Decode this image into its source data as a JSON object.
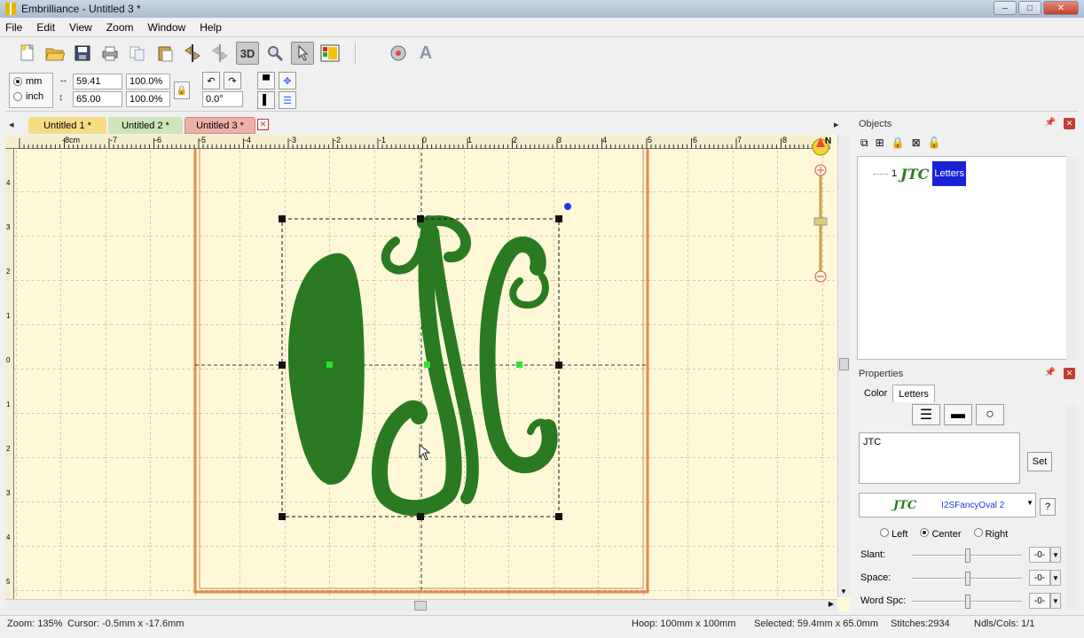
{
  "window": {
    "title": "Embrilliance -  Untitled 3 *",
    "minimize": "–",
    "maximize": "□",
    "close": "✕"
  },
  "menu": [
    "File",
    "Edit",
    "View",
    "Zoom",
    "Window",
    "Help"
  ],
  "toolbar": {
    "three_d": "3D"
  },
  "toolbar2": {
    "unit_mm": "mm",
    "unit_inch": "inch",
    "width_value": "59.41",
    "height_value": "65.00",
    "width_pct": "100.0%",
    "height_pct": "100.0%",
    "rotation": "0.0°"
  },
  "tabs": [
    {
      "label": "Untitled 1 *",
      "color": "#f6dc86"
    },
    {
      "label": "Untitled 2 *",
      "color": "#cfe4b8"
    },
    {
      "label": "Untitled 3 *",
      "color": "#f0b0a8"
    }
  ],
  "ruler": {
    "top_labels": [
      "-8cm",
      "-7",
      "-6",
      "-5",
      "-4",
      "-3",
      "-2",
      "-1",
      "0",
      "1",
      "2",
      "3",
      "4",
      "5",
      "6",
      "7",
      "8"
    ],
    "left_labels": [
      "4",
      "3",
      "2",
      "1",
      "0",
      "1",
      "2",
      "3",
      "4",
      "5"
    ]
  },
  "compass": "N",
  "design": {
    "monogram_text": "JTC",
    "thread_color": "#2a7a22"
  },
  "objects_panel": {
    "title": "Objects",
    "items": [
      {
        "index": "1",
        "label": "Letters"
      }
    ]
  },
  "properties_panel": {
    "title": "Properties",
    "tabs": [
      "Color",
      "Letters"
    ],
    "text_value": "JTC",
    "set_button": "Set",
    "font_name": "I2SFancyOval 2",
    "help": "?",
    "align_left": "Left",
    "align_center": "Center",
    "align_right": "Right",
    "slant_label": "Slant:",
    "slant_value": "-0-",
    "space_label": "Space:",
    "space_value": "-0-",
    "wordspc_label": "Word Spc:",
    "wordspc_value": "-0-"
  },
  "status": {
    "zoom": "Zoom: 135%",
    "cursor": "Cursor: -0.5mm x -17.6mm",
    "hoop": "Hoop: 100mm x 100mm",
    "selected": "Selected: 59.4mm x 65.0mm",
    "stitches": "Stitches:2934",
    "ndls": "Ndls/Cols: 1/1"
  }
}
